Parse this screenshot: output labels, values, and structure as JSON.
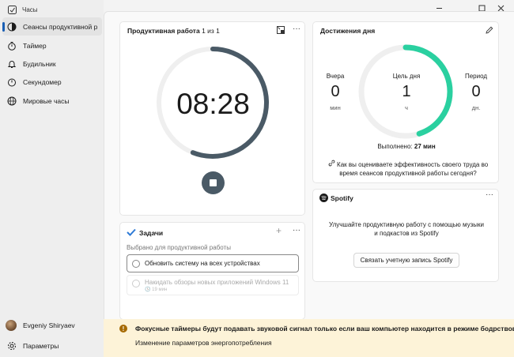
{
  "app": {
    "title": "Часы"
  },
  "window": {
    "minimize": "—",
    "maximize": "☐",
    "close": "✕"
  },
  "sidebar": {
    "items": [
      {
        "label": "Сеансы продуктивной р",
        "icon": "focus-icon"
      },
      {
        "label": "Таймер",
        "icon": "timer-icon"
      },
      {
        "label": "Будильник",
        "icon": "alarm-icon"
      },
      {
        "label": "Секундомер",
        "icon": "stopwatch-icon"
      },
      {
        "label": "Мировые часы",
        "icon": "globe-icon"
      }
    ],
    "user": "Evgeniy Shiryaev",
    "settings": "Параметры"
  },
  "focus": {
    "title": "Продуктивная работа",
    "session": "1 из 1",
    "time": "08:28",
    "progress": 0.56
  },
  "tasks": {
    "title": "Задачи",
    "add": "+",
    "hint": "Выбрано для продуктивной работы",
    "items": [
      {
        "label": "Обновить систему на всех устройствах"
      },
      {
        "label": "Накидать обзоры новых приложений Windows 11",
        "meta": "🕓 19 мин"
      }
    ]
  },
  "achievements": {
    "title": "Достижения дня",
    "yesterday": {
      "label": "Вчера",
      "value": "0",
      "unit": "мин"
    },
    "goal": {
      "label": "Цель дня",
      "value": "1",
      "unit": "ч"
    },
    "streak": {
      "label": "Период",
      "value": "0",
      "unit": "дн."
    },
    "done_label": "Выполнено:",
    "done_value": "27 мин",
    "progress": 0.45,
    "rate_text": "Как вы оцениваете эффективность своего труда во время сеансов продуктивной работы сегодня?"
  },
  "spotify": {
    "title": "Spotify",
    "text": "Улучшайте продуктивную работу с помощью музыки и подкастов из Spotify",
    "button": "Связать учетную запись Spotify"
  },
  "banner": {
    "message": "Фокусные таймеры будут подавать звуковой сигнал только если ваш компьютер находится в режиме бодрствования.",
    "link": "Изменение параметров энергопотребления"
  },
  "colors": {
    "accent": "#1a5fb4",
    "ring": "#4a5a66",
    "goal": "#2ad0a0",
    "banner": "#fdf3d8"
  }
}
